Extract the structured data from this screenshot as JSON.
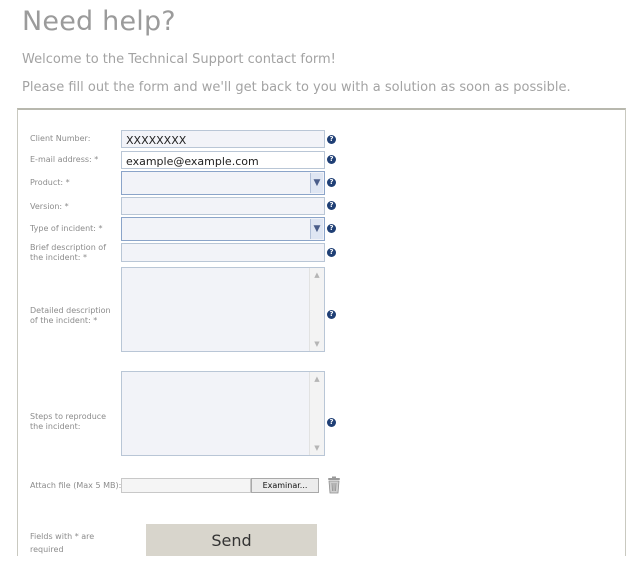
{
  "header": {
    "title": "Need help?",
    "welcome": "Welcome to the Technical Support contact form!",
    "instructions": "Please fill out the form and we'll get back to you with a solution as soon as possible."
  },
  "form": {
    "client_number": {
      "label": "Client Number:",
      "value": "XXXXXXXX"
    },
    "email": {
      "label": "E-mail address: *",
      "value": "example@example.com"
    },
    "product": {
      "label": "Product: *",
      "selected": ""
    },
    "version": {
      "label": "Version: *",
      "value": ""
    },
    "incident_type": {
      "label": "Type of incident: *",
      "selected": ""
    },
    "brief_description": {
      "label": "Brief description of the incident: *",
      "value": ""
    },
    "detailed_description": {
      "label": "Detailed description of the incident: *",
      "value": ""
    },
    "steps": {
      "label": "Steps to reproduce the incident:",
      "value": ""
    },
    "attach": {
      "label": "Attach file (Max 5 MB):",
      "browse_label": "Examinar..."
    },
    "help_icon": "question-circle-icon",
    "required_note": "Fields with * are required",
    "send_label": "Send"
  },
  "colors": {
    "help_icon": "#1f3f75",
    "send_button": "#d8d5cc",
    "field_background": "#f2f3f8"
  }
}
